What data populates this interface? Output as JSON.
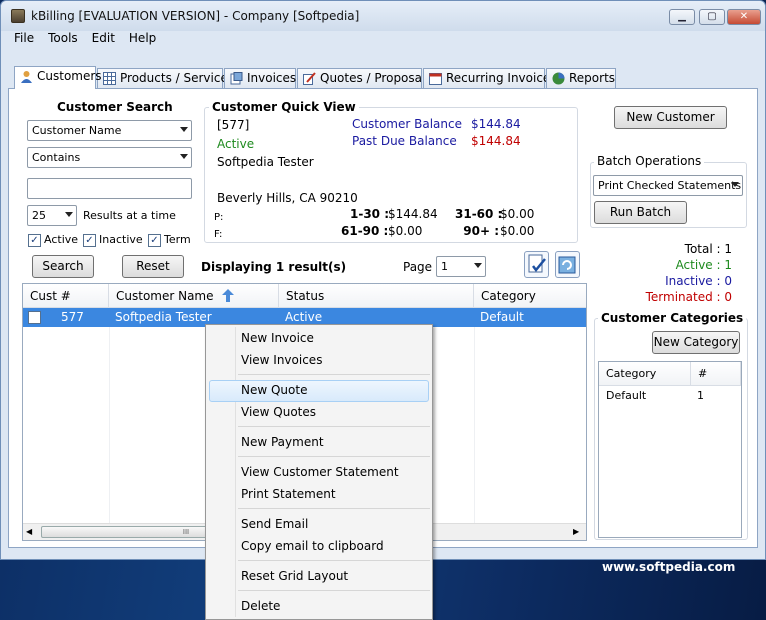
{
  "window": {
    "title": "kBilling [EVALUATION VERSION] - Company [Softpedia]",
    "min": "▁",
    "max": "▢",
    "close": "✕"
  },
  "menu": [
    "File",
    "Tools",
    "Edit",
    "Help"
  ],
  "tabs": [
    {
      "label": "Customers",
      "icon": "person-icon"
    },
    {
      "label": "Products / Services",
      "icon": "grid-icon"
    },
    {
      "label": "Invoices",
      "icon": "invoice-icon"
    },
    {
      "label": "Quotes / Proposals",
      "icon": "pen-icon"
    },
    {
      "label": "Recurring Invoices",
      "icon": "calendar-icon"
    },
    {
      "label": "Reports",
      "icon": "pie-chart-icon"
    }
  ],
  "search": {
    "title": "Customer Search",
    "field": "Customer Name",
    "operator": "Contains",
    "query": "",
    "results_per_page": "25",
    "results_label": "Results at a time",
    "filters": [
      {
        "label": "Active",
        "checked": true
      },
      {
        "label": "Inactive",
        "checked": true
      },
      {
        "label": "Term",
        "checked": true
      }
    ],
    "search_btn": "Search",
    "reset_btn": "Reset"
  },
  "quickview": {
    "title": "Customer Quick View",
    "id": "[577]",
    "status": "Active",
    "name": "Softpedia Tester",
    "address": "Beverly Hills, CA 90210",
    "phone_label": "P:",
    "fax_label": "F:",
    "balance_label": "Customer Balance",
    "balance": "$144.84",
    "pastdue_label": "Past Due Balance",
    "pastdue": "$144.84",
    "aging": [
      {
        "label": "1-30 :",
        "value": "$144.84"
      },
      {
        "label": "31-60 :",
        "value": "$0.00"
      },
      {
        "label": "61-90 :",
        "value": "$0.00"
      },
      {
        "label": "90+ :",
        "value": "$0.00"
      }
    ]
  },
  "results": {
    "text": "Displaying 1 result(s)",
    "page_label": "Page",
    "page": "1"
  },
  "grid": {
    "columns": [
      "Cust #",
      "Customer Name",
      "Status",
      "Category"
    ],
    "rows": [
      {
        "id": "577",
        "name": "Softpedia Tester",
        "status": "Active",
        "category": "Default"
      }
    ],
    "scroll_grip": "III"
  },
  "right": {
    "new_customer": "New Customer",
    "batch_title": "Batch Operations",
    "batch_op": "Print Checked Statements",
    "run_batch": "Run Batch",
    "total": "Total : 1",
    "active": "Active : 1",
    "inactive": "Inactive : 0",
    "terminated": "Terminated : 0",
    "categories_title": "Customer Categories",
    "new_category": "New Category",
    "cat_cols": [
      "Category",
      "#"
    ],
    "cat_rows": [
      {
        "name": "Default",
        "count": "1"
      }
    ]
  },
  "context_menu": [
    "New Invoice",
    "View Invoices",
    "New Quote",
    "View Quotes",
    "New Payment",
    "View Customer Statement",
    "Print Statement",
    "Send Email",
    "Copy email to clipboard",
    "Reset Grid Layout",
    "Delete"
  ],
  "watermark": "www.softpedia.com",
  "colors": {
    "accent": "#3b87e0",
    "blue_text": "#1a1aa0",
    "red_text": "#c00000",
    "green_text": "#1e8a1e",
    "desktop": "#0d2c62"
  }
}
